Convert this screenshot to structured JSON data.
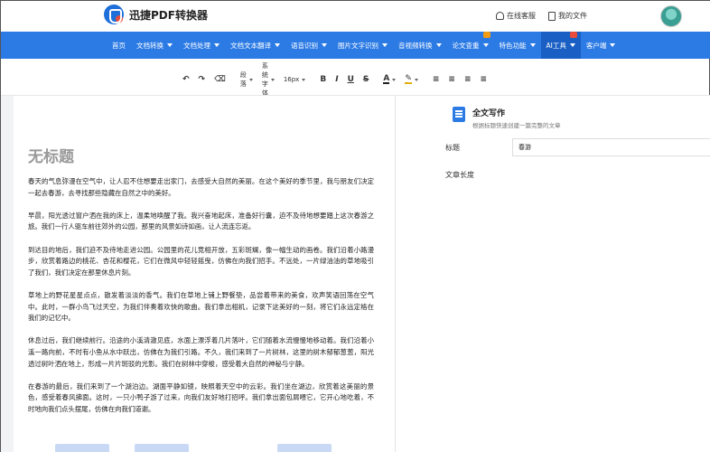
{
  "header": {
    "app_name": "迅捷PDF转换器",
    "links": [
      {
        "label": "在线客服",
        "icon": "headset-icon"
      },
      {
        "label": "我的文件",
        "icon": "document-icon"
      }
    ]
  },
  "nav": {
    "items": [
      {
        "label": "首页",
        "has_caret": false
      },
      {
        "label": "文档转换",
        "has_caret": true
      },
      {
        "label": "文档处理",
        "has_caret": true
      },
      {
        "label": "文档文本翻译",
        "has_caret": true
      },
      {
        "label": "语音识别",
        "has_caret": true
      },
      {
        "label": "图片文字识别",
        "has_caret": true
      },
      {
        "label": "音视频转换",
        "has_caret": true
      },
      {
        "label": "论文查重",
        "has_caret": true,
        "badge": "orange"
      },
      {
        "label": "特色功能",
        "has_caret": true
      },
      {
        "label": "AI工具",
        "has_caret": true,
        "active": true,
        "badge": "red"
      },
      {
        "label": "客户端",
        "has_caret": true
      }
    ]
  },
  "toolbar": {
    "undo": "↶",
    "redo": "↷",
    "clear_format": "⌫",
    "paragraph": "段落",
    "font": "系统字体",
    "size": "16px",
    "bold": "B",
    "italic": "I",
    "underline": "U",
    "strike": "S",
    "font_color": "A",
    "highlight": "✎",
    "align_left": "≡",
    "align_center": "≡",
    "align_right": "≡",
    "justify": "≡"
  },
  "document": {
    "title": "无标题",
    "paragraphs": [
      "春天的气息弥漫在空气中，让人忍不住想要走出家门，去感受大自然的美丽。在这个美好的季节里，我与朋友们决定一起去春游，去寻找那些隐藏在自然之中的美好。",
      "早晨，阳光透过窗户洒在我的床上，温柔地唤醒了我。我兴奋地起床，准备好行囊，迫不及待地想要踏上这次春游之旅。我们一行人驱车前往郊外的公园，那里的风景如诗如画，让人流连忘返。",
      "到达目的地后，我们迫不及待地走进公园。公园里的花儿竞相开放，五彩斑斓，像一幅生动的画卷。我们沿着小路漫步，欣赏着路边的桃花、杏花和樱花，它们在微风中轻轻摇曳，仿佛在向我们招手。不远处，一片绿油油的草地吸引了我们，我们决定在那里休息片刻。",
      "草地上的野花星星点点，散发着淡淡的香气。我们在草地上铺上野餐垫，品尝着带来的美食，欢声笑语回荡在空气中。此时，一群小鸟飞过天空，为我们伴奏着欢快的歌曲。我们拿出相机，记录下这美好的一刻，将它们永远定格在我们的记忆中。",
      "休息过后，我们继续前行。沿途的小溪清澈见底，水面上漂浮着几片落叶，它们随着水流慢慢地移动着。我们沿着小溪一路向前，不时有小鱼从水中跃出，仿佛在为我们引路。不久，我们来到了一片树林，这里的树木郁郁葱葱，阳光透过树叶洒在地上，形成一片片斑驳的光影。我们在树林中穿梭，感受着大自然的神秘与宁静。",
      "在春游的最后，我们来到了一个湖泊边。湖面平静如镜，映照着天空中的云彩。我们坐在湖边，欣赏着这美丽的景色，感受着春风拂面。这时，一只小鸭子游了过来，向我们友好地打招呼。我们拿出面包屑喂它，它开心地吃着，不时地向我们点头摆尾，仿佛在向我们道谢。"
    ]
  },
  "panel": {
    "tool_name": "全文写作",
    "tool_desc": "根据标题快速创建一篇完整的文章",
    "title_label": "标题",
    "title_value": "春游",
    "length_label": "文章长度"
  },
  "colors": {
    "nav_bg": "#2c7be5",
    "nav_active": "#1a5fc4",
    "accent": "#2c7be5",
    "title_gray": "#999999"
  }
}
